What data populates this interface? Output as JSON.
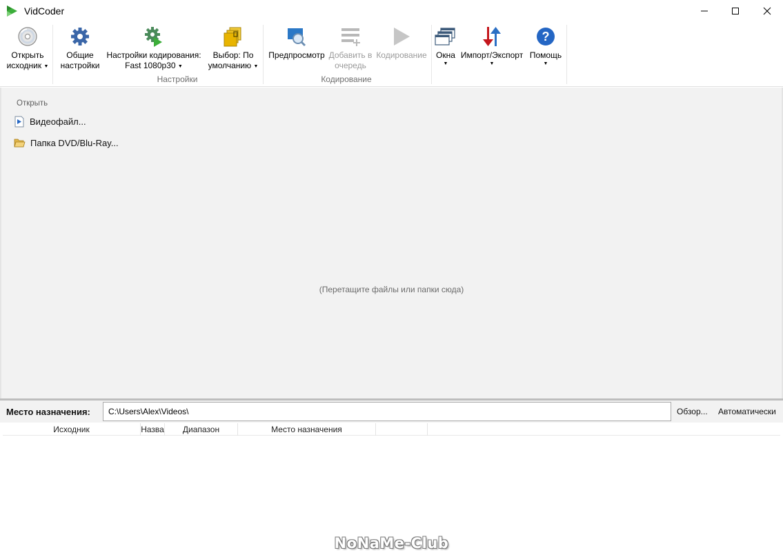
{
  "window": {
    "title": "VidCoder",
    "icon": "vidcoder-play-icon",
    "controls": [
      "minimize-icon",
      "maximize-icon",
      "close-icon"
    ]
  },
  "ribbon": {
    "buttons": {
      "open_source": {
        "line1": "Открыть",
        "line2": "исходник",
        "icon": "disc-icon",
        "has_dropdown": true
      },
      "general_settings": {
        "line1": "Общие",
        "line2": "настройки",
        "icon": "gear-icon"
      },
      "encoding_settings": {
        "line1": "Настройки кодирования:",
        "line2": "Fast 1080p30",
        "icon": "gear-play-icon",
        "has_dropdown": true
      },
      "default_picker": {
        "line1": "Выбор: По",
        "line2": "умолчанию",
        "icon": "folder-stack-icon",
        "has_dropdown": true
      },
      "preview": {
        "line1": "Предпросмотр",
        "icon": "preview-magnifier-icon"
      },
      "add_to_queue": {
        "line1": "Добавить в",
        "line2": "очередь",
        "icon": "queue-add-icon",
        "disabled": true
      },
      "encode": {
        "line1": "Кодирование",
        "icon": "play-icon",
        "disabled": true
      },
      "windows": {
        "line1": "Окна",
        "icon": "windows-stack-icon",
        "has_dropdown": true
      },
      "import_export": {
        "line1": "Импорт/Экспорт",
        "icon": "import-export-arrows-icon",
        "has_dropdown": true
      },
      "help": {
        "line1": "Помощь",
        "icon": "help-question-icon",
        "has_dropdown": true
      }
    },
    "groups": {
      "settings": "Настройки",
      "encoding": "Кодирование"
    }
  },
  "main": {
    "open_header": "Открыть",
    "items": [
      {
        "label": "Видеофайл...",
        "icon": "video-file-icon"
      },
      {
        "label": "Папка DVD/Blu-Ray...",
        "icon": "open-folder-icon"
      }
    ],
    "drop_hint": "(Перетащите файлы или папки сюда)"
  },
  "destination": {
    "label": "Место назначения:",
    "path": "C:\\Users\\Alex\\Videos\\",
    "browse_label": "Обзор...",
    "auto_label": "Автоматически"
  },
  "queue": {
    "columns": [
      "Исходник",
      "Назва",
      "Диапазон",
      "Место назначения",
      ""
    ]
  },
  "watermark": "NoNaMe-Club",
  "colors": {
    "main_bg": "#f2f2f2",
    "disabled_text": "#9a9a9a",
    "group_label": "#6d6d6d",
    "preview_blue": "#2b78c6",
    "import_red": "#c4161c",
    "help_blue": "#2466c4",
    "gear_blue": "#3a66a8",
    "folder_yellow": "#e8b400",
    "play_green": "#3cae3a"
  }
}
